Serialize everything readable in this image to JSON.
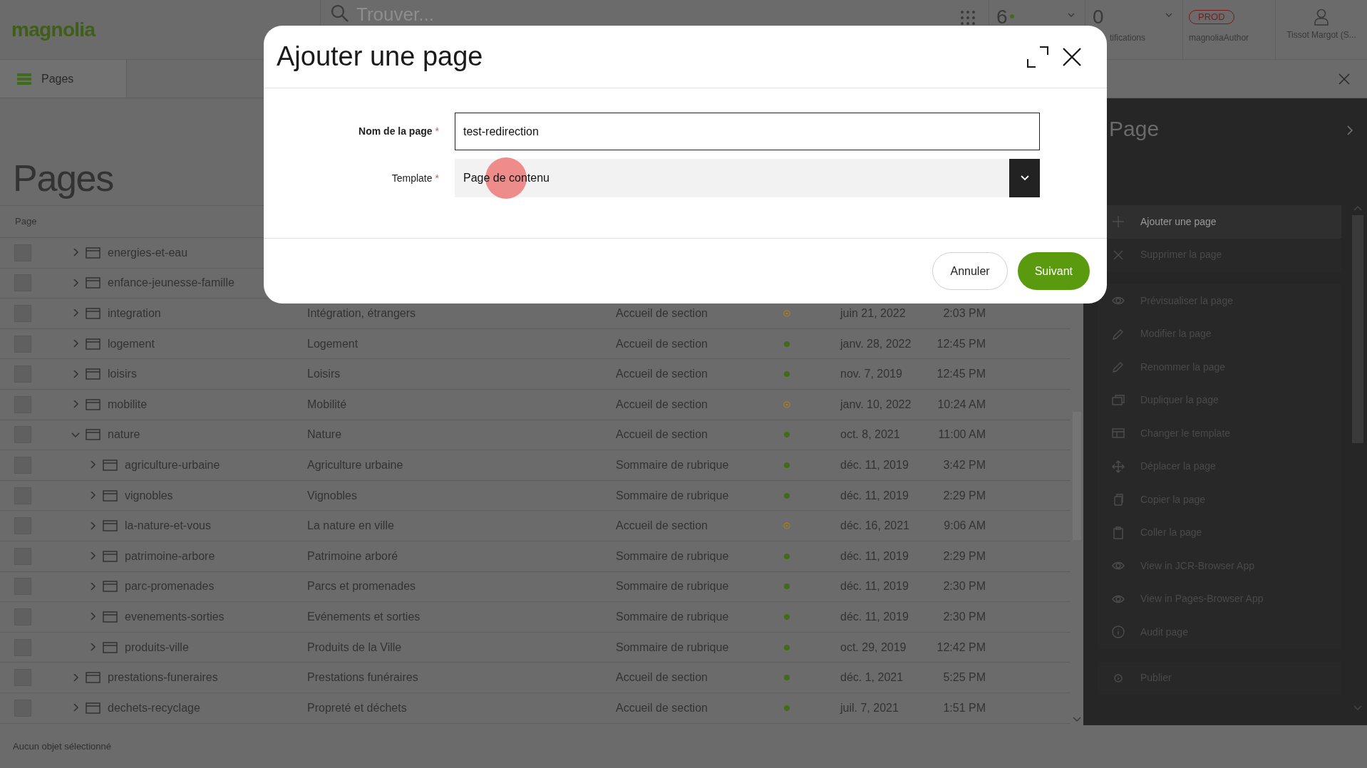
{
  "top_bar": {
    "logo": "magnolia",
    "search": {
      "placeholder": "Trouver..."
    },
    "tasks_count": "6",
    "notifications_count": "0",
    "notifications_label": "tifications",
    "environment_badge": "PROD",
    "instance": "magnoliaAuthor",
    "user": "Tissot Margot (S..."
  },
  "app_tabs": [
    {
      "label": "Pages",
      "selected": true
    }
  ],
  "heading": "Pages",
  "table": {
    "columns": [
      "Page"
    ],
    "rows": [
      {
        "name": "energies-et-eau",
        "expanded": false,
        "checked": false
      },
      {
        "name": "enfance-jeunesse-famille",
        "expanded": false,
        "checked": false
      },
      {
        "name": "integration",
        "title": "Intégration, étrangers",
        "template": "Accueil de section",
        "kind": "modified",
        "date": "juin 21, 2022",
        "time": "2:03 PM",
        "expanded": false,
        "checked": false
      },
      {
        "name": "logement",
        "title": "Logement",
        "template": "Accueil de section",
        "kind": "published",
        "date": "janv. 28, 2022",
        "time": "12:45 PM",
        "expanded": false,
        "checked": false
      },
      {
        "name": "loisirs",
        "title": "Loisirs",
        "template": "Accueil de section",
        "kind": "published",
        "date": "nov. 7, 2019",
        "time": "12:45 PM",
        "expanded": false,
        "checked": false
      },
      {
        "name": "mobilite",
        "title": "Mobilité",
        "template": "Accueil de section",
        "kind": "modified",
        "date": "janv. 10, 2022",
        "time": "10:24 AM",
        "expanded": false,
        "checked": false
      },
      {
        "name": "nature",
        "title": "Nature",
        "template": "Accueil de section",
        "kind": "published",
        "date": "oct. 8, 2021",
        "time": "11:00 AM",
        "expanded": true,
        "checked": false,
        "children": [
          {
            "name": "agriculture-urbaine",
            "title": "Agriculture urbaine",
            "template": "Sommaire de rubrique",
            "kind": "published",
            "date": "déc. 11, 2019",
            "time": "3:42 PM",
            "expanded": false,
            "checked": false
          },
          {
            "name": "vignobles",
            "title": "Vignobles",
            "template": "Sommaire de rubrique",
            "kind": "published",
            "date": "déc. 11, 2019",
            "time": "2:29 PM",
            "expanded": false,
            "checked": false
          },
          {
            "name": "la-nature-et-vous",
            "title": "La nature en ville",
            "template": "Accueil de section",
            "kind": "modified",
            "date": "déc. 16, 2021",
            "time": "9:06 AM",
            "expanded": false,
            "checked": false
          },
          {
            "name": "patrimoine-arbore",
            "title": "Patrimoine arboré",
            "template": "Sommaire de rubrique",
            "kind": "published",
            "date": "déc. 11, 2019",
            "time": "2:29 PM",
            "expanded": false,
            "checked": false
          },
          {
            "name": "parc-promenades",
            "title": "Parcs et promenades",
            "template": "Sommaire de rubrique",
            "kind": "published",
            "date": "déc. 11, 2019",
            "time": "2:30 PM",
            "expanded": false,
            "checked": false
          },
          {
            "name": "evenements-sorties",
            "title": "Evénements et sorties",
            "template": "Sommaire de rubrique",
            "kind": "published",
            "date": "déc. 11, 2019",
            "time": "2:30 PM",
            "expanded": false,
            "checked": false
          },
          {
            "name": "produits-ville",
            "title": "Produits de la Ville",
            "template": "Sommaire de rubrique",
            "kind": "published",
            "date": "oct. 29, 2019",
            "time": "12:42 PM",
            "expanded": false,
            "checked": false
          }
        ]
      },
      {
        "name": "prestations-funeraires",
        "title": "Prestations funéraires",
        "template": "Accueil de section",
        "kind": "published",
        "date": "déc. 1, 2021",
        "time": "5:25 PM",
        "expanded": false,
        "checked": false
      },
      {
        "name": "dechets-recyclage",
        "title": "Propreté et déchets",
        "template": "Accueil de section",
        "kind": "published",
        "date": "juil. 7, 2021",
        "time": "1:51 PM",
        "expanded": false,
        "checked": false
      }
    ]
  },
  "status_bar": "Aucun objet sélectionné",
  "action_panel": {
    "title": "Page",
    "groups": [
      [
        {
          "label": "Ajouter une page",
          "kind": "plus",
          "disabled": false
        },
        {
          "label": "Supprimer la page",
          "kind": "cross",
          "disabled": true
        }
      ],
      [
        {
          "label": "Prévisualiser la page",
          "kind": "eye",
          "disabled": true
        },
        {
          "label": "Modifier la page",
          "kind": "pencil",
          "disabled": true
        },
        {
          "label": "Renommer la page",
          "kind": "pencil",
          "disabled": true
        },
        {
          "label": "Dupliquer la page",
          "kind": "duplicate",
          "disabled": true
        },
        {
          "label": "Changer le template",
          "kind": "template",
          "disabled": true
        },
        {
          "label": "Déplacer la page",
          "kind": "move",
          "disabled": true
        },
        {
          "label": "Copier la page",
          "kind": "copy",
          "disabled": true
        },
        {
          "label": "Coller la page",
          "kind": "clipboard",
          "disabled": true
        },
        {
          "label": "View in JCR-Browser App",
          "kind": "eye",
          "disabled": true
        },
        {
          "label": "View in Pages-Browser App",
          "kind": "eye",
          "disabled": true
        },
        {
          "label": "Audit page",
          "kind": "info",
          "disabled": true
        }
      ],
      [
        {
          "label": "Publier",
          "kind": "info-small",
          "disabled": true
        }
      ]
    ]
  },
  "dialog": {
    "title": "Ajouter une page",
    "fields": [
      {
        "kind": "text",
        "label": "Nom de la page",
        "required_mark": "*",
        "value": "test-redirection"
      },
      {
        "kind": "select",
        "label": "Template",
        "required_mark": "*",
        "value": "Page de contenu"
      }
    ],
    "buttons": [
      {
        "label": "Annuler",
        "kind": "secondary"
      },
      {
        "label": "Suivant",
        "kind": "primary"
      }
    ]
  }
}
